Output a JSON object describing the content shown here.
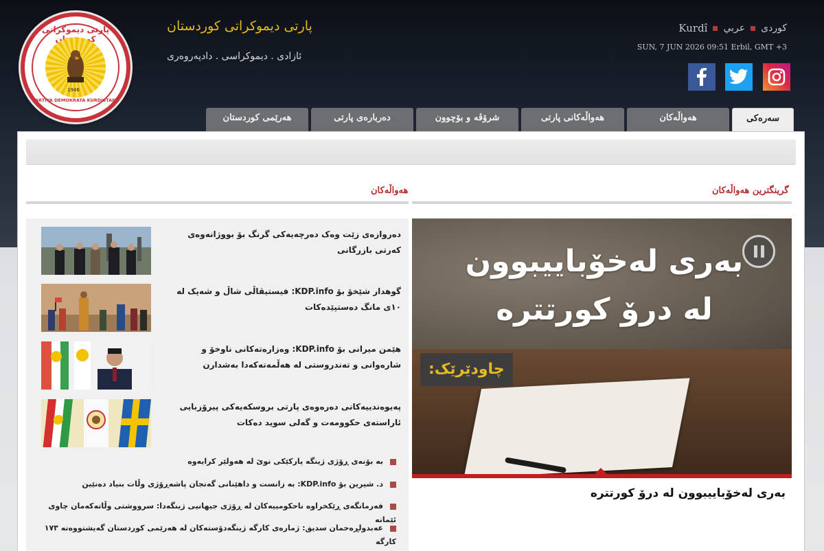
{
  "header": {
    "title": "پارتی دیموکراتی کوردستان",
    "slogan": "ئازادی . دیموکراسی . دادپەروەری",
    "logo": {
      "top_text": "پارتی دیموکراتی کوردستان",
      "bottom_text": "PARTIYA DEMOKRATA KURDISTANÊ",
      "year": "1946"
    },
    "languages": {
      "kurdi_latin": "Kurdî",
      "arabic": "عربي",
      "kurdish": "کوردی"
    },
    "datetime": "SUN, 7 JUN 2026 09:51 Erbil, GMT +3",
    "social": [
      "facebook-icon",
      "twitter-icon",
      "instagram-icon"
    ]
  },
  "nav": {
    "tabs": [
      {
        "label": "سەرەکی",
        "active": true
      },
      {
        "label": "هەواڵەکان",
        "active": false
      },
      {
        "label": "هەواڵەکانی پارتی",
        "active": false
      },
      {
        "label": "شرۆڤە و بۆچوون",
        "active": false
      },
      {
        "label": "دەربارەی پارتی",
        "active": false
      },
      {
        "label": "هەرێمی کوردستان",
        "active": false
      }
    ]
  },
  "sections": {
    "news_heading": "هەواڵەکان",
    "featured_heading": "گرینگترین هەواڵەکان"
  },
  "news": [
    {
      "text": "دەروازەی زێت وەک دەرچەیەکی گرنگ بۆ بووژانەوەی کەرتی بازرگانی",
      "thumb": "officials-photo"
    },
    {
      "text": "گوهدار شێخۆ بۆ KDP.info: فیستیڤاڵی شاڵ و شەپک لە ١٠ی مانگ دەستپێدەکات",
      "thumb": "festival-photo"
    },
    {
      "text": "هێمن میرانی بۆ KDP.info: وەزارەتەکانی ناوخۆ و شارەوانی و تەندروستی لە هەڵمەتەکەدا بەشدارن",
      "thumb": "speaker-photo"
    },
    {
      "text": "پەیوەندییەکانی دەرەوەی پارتی بروسکەیەکی پیرۆزبایی ئاراستەی حکوومەت و گەلی سوید دەکات",
      "thumb": "flags-photo"
    }
  ],
  "bullets": [
    "بە بۆنەی ڕۆژی ژینگە پارکێکی نوێ لە هەولێر کرایەوە",
    "د. شیرین بۆ KDP.info: بە زانست و داهێنانی گەنجان پاشەڕۆژی وڵات بنیاد دەنێین",
    "فەرمانگەی ڕێکخراوە ناحکومییەکان لە ڕۆژی جیهانیی ژینگەدا: سرووشتی وڵاتەکەمان چاوی ئێمانە",
    "عەبدولڕەحمان سدیق: ژمارەی کارگە ژینگەدۆستەکان لە هەرێمی کوردستان گەیشتووەتە ١٧٣ کارگە"
  ],
  "featured": {
    "image_title": "بەری لەخۆباییبوون لە درۆ کورتترە",
    "badge": "چاودێرێک:",
    "caption": "بەری لەخۆباییبوون لە درۆ کورتترە"
  },
  "colors": {
    "accent": "#b72c2c",
    "title_gold": "#e8b820",
    "tab_bg": "#6c6e72",
    "feature_bar": "#c21e1e"
  }
}
